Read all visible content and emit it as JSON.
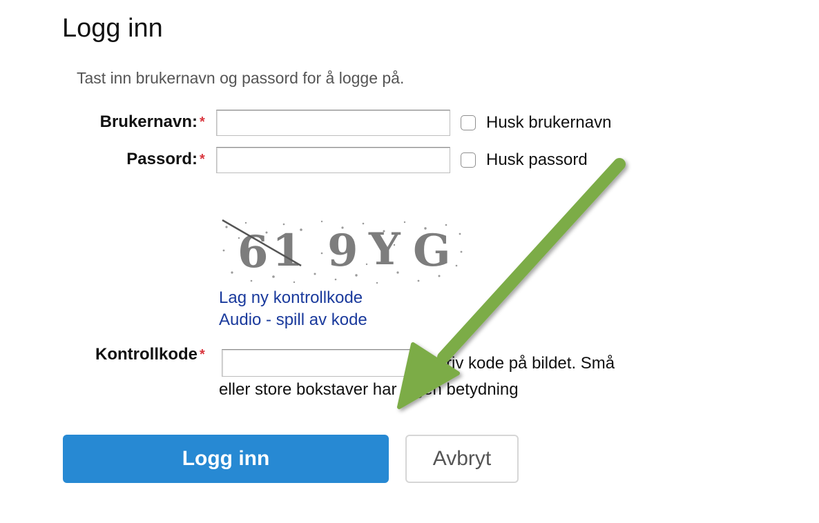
{
  "page": {
    "title": "Logg inn"
  },
  "login": {
    "intro": "Tast inn brukernavn og passord for å logge på.",
    "username": {
      "label": "Brukernavn:",
      "required_mark": "*",
      "value": "",
      "remember_label": "Husk brukernavn",
      "remember_checked": false
    },
    "password": {
      "label": "Passord:",
      "required_mark": "*",
      "value": "",
      "remember_label": "Husk passord",
      "remember_checked": false
    },
    "captcha": {
      "image_text": "619YG",
      "new_code_link": "Lag ny kontrollkode",
      "audio_link": "Audio - spill av kode",
      "label": "Kontrollkode",
      "required_mark": "*",
      "value": "",
      "help_line1": "Skriv kode på bildet. Små",
      "help_line2": "eller store bokstaver har ingen betydning"
    },
    "buttons": {
      "submit": "Logg inn",
      "cancel": "Avbryt"
    }
  },
  "colors": {
    "primary_button": "#2789d3",
    "link": "#1a3a9c",
    "required": "#d9363e",
    "annotation_arrow": "#7cac46"
  },
  "annotation": {
    "type": "arrow",
    "icon": "green-arrow-icon",
    "points_to": "captcha-input"
  }
}
